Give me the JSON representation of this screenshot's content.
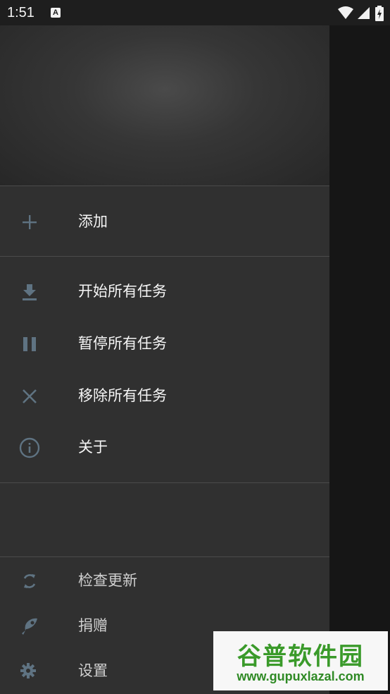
{
  "status_bar": {
    "time": "1:51",
    "notification_letter": "A",
    "icons": [
      "wifi-icon",
      "cell-signal-icon",
      "battery-charging-icon"
    ]
  },
  "drawer": {
    "primary": [
      {
        "label": "添加",
        "icon": "add-icon"
      }
    ],
    "tasks": [
      {
        "label": "开始所有任务",
        "icon": "download-icon"
      },
      {
        "label": "暂停所有任务",
        "icon": "pause-icon"
      },
      {
        "label": "移除所有任务",
        "icon": "close-icon"
      },
      {
        "label": "关于",
        "icon": "info-icon"
      }
    ],
    "footer": [
      {
        "label": "检查更新",
        "icon": "sync-icon"
      },
      {
        "label": "捐赠",
        "icon": "donate-icon"
      },
      {
        "label": "设置",
        "icon": "gear-icon"
      }
    ]
  },
  "colors": {
    "drawer_bg": "#303030",
    "icon": "#5f7382",
    "text": "#f5f5f5"
  },
  "watermark": {
    "brand": "谷普软件园",
    "url": "www.gupuxlazal.com"
  }
}
